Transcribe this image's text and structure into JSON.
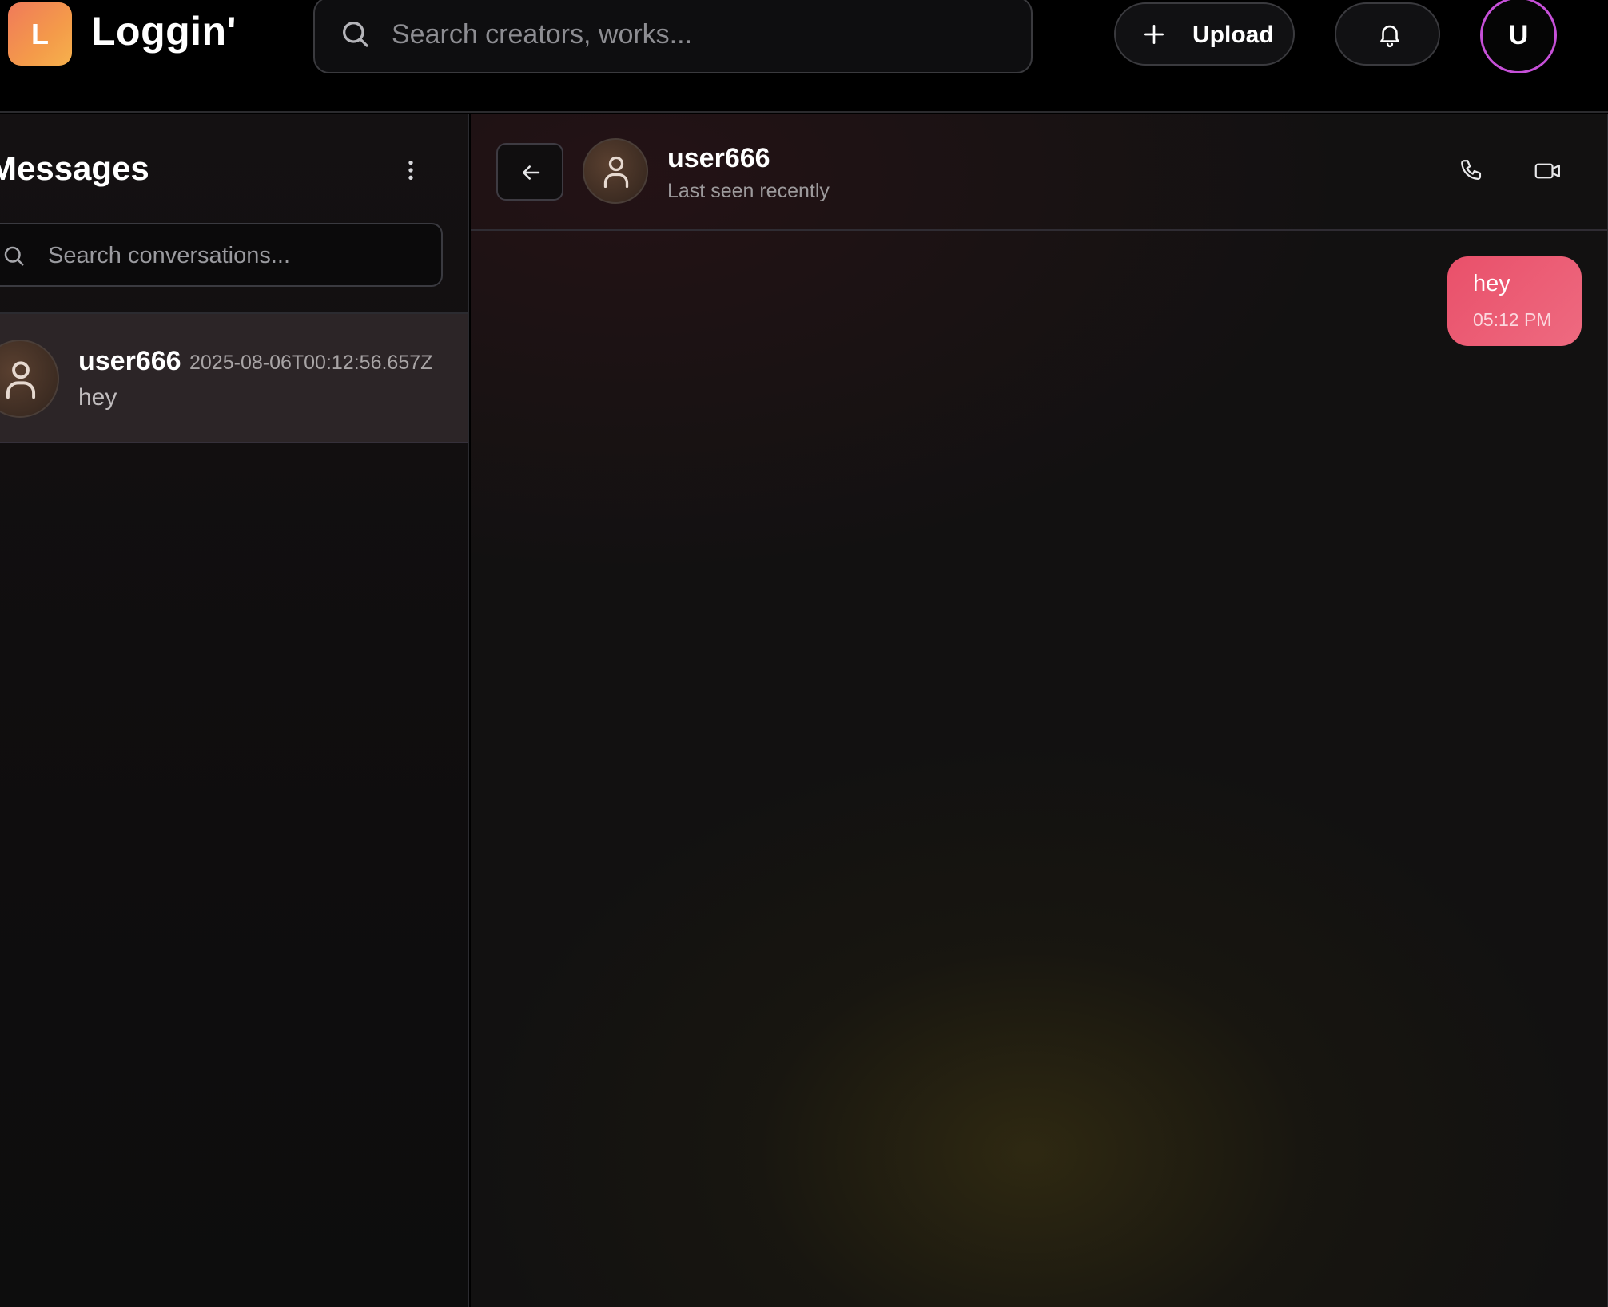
{
  "app": {
    "logo_letter": "L",
    "name": "Loggin'",
    "search_placeholder": "Search creators, works...",
    "upload_label": "Upload",
    "user_initial": "U",
    "brand_gradient": [
      "#f07a5a",
      "#f6b14c"
    ],
    "accent_ring": "#c650d8"
  },
  "sidebar": {
    "title": "Messages",
    "search_placeholder": "Search conversations...",
    "conversations": [
      {
        "name": "user666",
        "timestamp": "2025-08-06T00:12:56.657Z",
        "preview": "hey",
        "avatar_icon": "user-icon"
      }
    ]
  },
  "chat": {
    "name": "user666",
    "status": "Last seen recently",
    "messages": [
      {
        "text": "hey",
        "time": "05:12 PM",
        "direction": "outgoing",
        "color": "#e9506a"
      }
    ]
  }
}
